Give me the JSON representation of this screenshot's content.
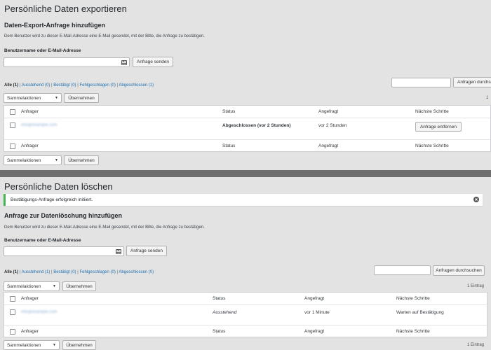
{
  "export": {
    "title": "Persönliche Daten exportieren",
    "add_heading": "Daten-Export-Anfrage hinzufügen",
    "description": "Dem Benutzer wird zu dieser E-Mail-Adresse eine E-Mail gesendet, mit der Bitte, die Anfrage zu bestätigen.",
    "field_label": "Benutzername oder E-Mail-Adresse",
    "input_value": "",
    "send_button": "Anfrage senden",
    "filters": {
      "all": "Alle (1)",
      "pending": "Ausstehend (0)",
      "confirmed": "Bestätigt (0)",
      "failed": "Fehlgeschlagen (0)",
      "completed": "Abgeschlossen (1)",
      "sep": "|"
    },
    "search_input_value": "",
    "search_button": "Anfragen durchs",
    "bulk_select": "Sammelaktionen",
    "apply_button": "Übernehmen",
    "items_count": "1",
    "columns": {
      "requester": "Anfrager",
      "status": "Status",
      "requested": "Angefragt",
      "next": "Nächste Schritte"
    },
    "row": {
      "email": "info@example.com",
      "status": "Abgeschlossen (vor 2 Stunden)",
      "requested": "vor 2 Stunden",
      "action": "Anfrage entfernen"
    }
  },
  "erase": {
    "title": "Persönliche Daten löschen",
    "notice": "Bestätigungs-Anfrage erfolgreich initiiert.",
    "add_heading": "Anfrage zur Datenlöschung hinzufügen",
    "description": "Dem Benutzer wird zu dieser E-Mail-Adresse eine E-Mail gesendet, mit der Bitte, die Anfrage zu bestätigen.",
    "field_label": "Benutzername oder E-Mail-Adresse",
    "input_value": "",
    "send_button": "Anfrage senden",
    "filters": {
      "all": "Alle (1)",
      "pending": "Ausstehend (1)",
      "confirmed": "Bestätigt (0)",
      "failed": "Fehlgeschlagen (0)",
      "completed": "Abgeschlossen (0)",
      "sep": "|"
    },
    "search_input_value": "",
    "search_button": "Anfragen durchsuchen",
    "bulk_select": "Sammelaktionen",
    "apply_button": "Übernehmen",
    "items_count": "1 Eintrag",
    "columns": {
      "requester": "Anfrager",
      "status": "Status",
      "requested": "Angefragt",
      "next": "Nächste Schritte"
    },
    "row": {
      "email": "info@example.com",
      "status": "Ausstehend",
      "requested": "vor 1 Minute",
      "next": "Warten auf Bestätigung"
    },
    "bottom_bulk_select": "Sammelaktionen",
    "bottom_apply_button": "Übernehmen",
    "bottom_count": "1 Eintrag"
  },
  "icons": {
    "picker": "contact-picker-icon",
    "dismiss": "dismiss-icon",
    "dropdown": "chevron-down-icon"
  },
  "colors": {
    "link": "#2271b1",
    "notice_success": "#46b450",
    "divider": "#6e6e6e"
  }
}
